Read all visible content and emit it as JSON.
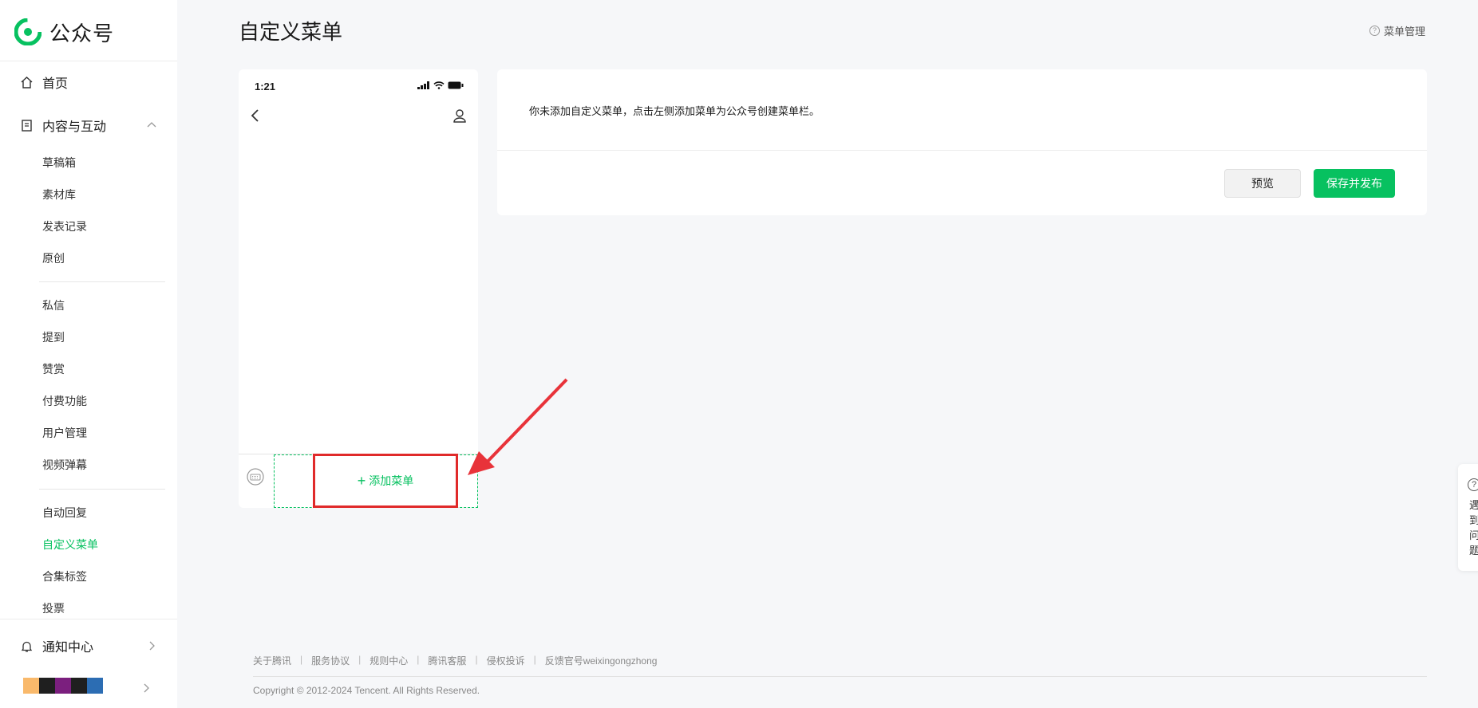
{
  "app": {
    "name": "公众号"
  },
  "sidebar": {
    "home": "首页",
    "content_section": "内容与互动",
    "group1": [
      "草稿箱",
      "素材库",
      "发表记录",
      "原创"
    ],
    "group2": [
      "私信",
      "提到",
      "赞赏",
      "付费功能",
      "用户管理",
      "视频弹幕"
    ],
    "group3": [
      "自动回复",
      "自定义菜单",
      "合集标签",
      "投票"
    ],
    "notice": "通知中心",
    "account_colors": [
      "#f9b96b",
      "#1f1f1f",
      "#7b1f7e",
      "#1f1f1f",
      "#2c6db3"
    ]
  },
  "header": {
    "title": "自定义菜单",
    "menu_manage": "菜单管理",
    "help_glyph": "?"
  },
  "phone": {
    "time": "1:21",
    "add_menu": "添加菜单",
    "plus": "+"
  },
  "panel": {
    "message": "你未添加自定义菜单，点击左侧添加菜单为公众号创建菜单栏。",
    "preview": "预览",
    "save_publish": "保存并发布"
  },
  "footer": {
    "links": [
      "关于腾讯",
      "服务协议",
      "规则中心",
      "腾讯客服",
      "侵权投诉",
      "反馈官号weixingongzhong"
    ],
    "separator": "|",
    "copyright": "Copyright © 2012-2024 Tencent. All Rights Reserved."
  },
  "help_float": {
    "glyph": "?",
    "text": "遇到问题"
  },
  "colors": {
    "accent": "#07c160",
    "annotation": "#e02a2a",
    "background": "#f6f7f9"
  }
}
